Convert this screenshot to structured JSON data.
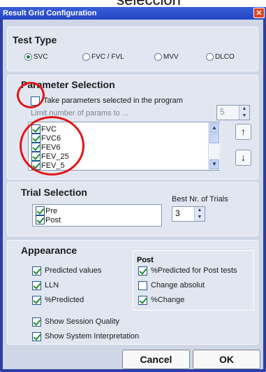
{
  "top_caption": "seleccion",
  "window": {
    "title": "Result Grid Configuration",
    "close_icon": "close-icon"
  },
  "test_type": {
    "title": "Test Type",
    "options": [
      {
        "label": "SVC",
        "selected": true
      },
      {
        "label": "FVC / FVL",
        "selected": false
      },
      {
        "label": "MVV",
        "selected": false
      },
      {
        "label": "DLCO",
        "selected": false
      }
    ]
  },
  "parameter_selection": {
    "title": "Parameter Selection",
    "take_params_label": "Take parameters selected in the program",
    "take_params_checked": false,
    "limit_label": "Limit number of params to ...",
    "limit_value": "5",
    "params": [
      {
        "label": "FVC",
        "checked": true
      },
      {
        "label": "FVC6",
        "checked": true
      },
      {
        "label": "FEV6",
        "checked": true
      },
      {
        "label": "FEV_25",
        "checked": true
      },
      {
        "label": "FEV_5",
        "checked": true
      }
    ],
    "move_up_icon": "arrow-up-icon",
    "move_down_icon": "arrow-down-icon"
  },
  "trial_selection": {
    "title": "Trial Selection",
    "items": [
      {
        "label": "Pre",
        "checked": true
      },
      {
        "label": "Post",
        "checked": true
      }
    ],
    "best_label": "Best Nr. of Trials",
    "best_value": "3"
  },
  "appearance": {
    "title": "Appearance",
    "left_options": [
      {
        "label": "Predicted values",
        "checked": true
      },
      {
        "label": "LLN",
        "checked": true
      },
      {
        "label": "%Predicted",
        "checked": true
      }
    ],
    "post_title": "Post",
    "post_options": [
      {
        "label": "%Predicted for Post tests",
        "checked": true
      },
      {
        "label": "Change absolut",
        "checked": false
      },
      {
        "label": "%Change",
        "checked": true
      }
    ],
    "extra_options": [
      {
        "label": "Show Session Quality",
        "checked": true
      },
      {
        "label": "Show System Interpretation",
        "checked": true
      }
    ]
  },
  "buttons": {
    "cancel": "Cancel",
    "ok": "OK"
  },
  "colors": {
    "title_bar": "#2245c4",
    "panel": "#e1e6f1",
    "check": "#1f8b2b",
    "annotation": "#e11414"
  }
}
